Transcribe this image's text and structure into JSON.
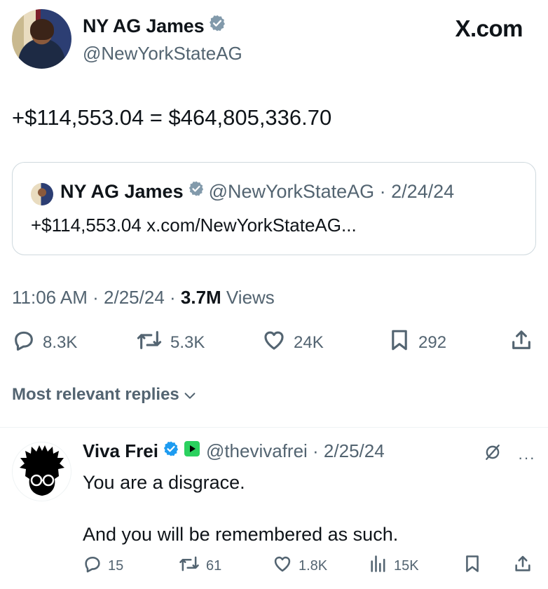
{
  "header": {
    "author_name": "NY AG James",
    "author_handle": "@NewYorkStateAG",
    "brand": "X.com"
  },
  "tweet": {
    "text": "+$114,553.04 = $464,805,336.70",
    "quote": {
      "author_name": "NY AG James",
      "meta": "@NewYorkStateAG · 2/24/24",
      "text": "+$114,553.04 x.com/NewYorkStateAG..."
    },
    "timestamp": "11:06 AM · 2/25/24 · ",
    "views_count": "3.7M",
    "views_label": " Views",
    "actions": {
      "replies": "8.3K",
      "reposts": "5.3K",
      "likes": "24K",
      "bookmarks": "292"
    }
  },
  "replies_section": {
    "sort_label": "Most relevant replies"
  },
  "reply": {
    "author_name": "Viva Frei",
    "meta": "@thevivafrei · 2/25/24",
    "text_line1": "You are a disgrace.",
    "text_line2": "And you will be remembered as such.",
    "more": "···",
    "actions": {
      "replies": "15",
      "reposts": "61",
      "likes": "1.8K",
      "views": "15K"
    }
  },
  "colors": {
    "verified": "#829aab",
    "secondary_text": "#536471",
    "border": "#cfd9de",
    "play_badge": "#2bd15f"
  }
}
